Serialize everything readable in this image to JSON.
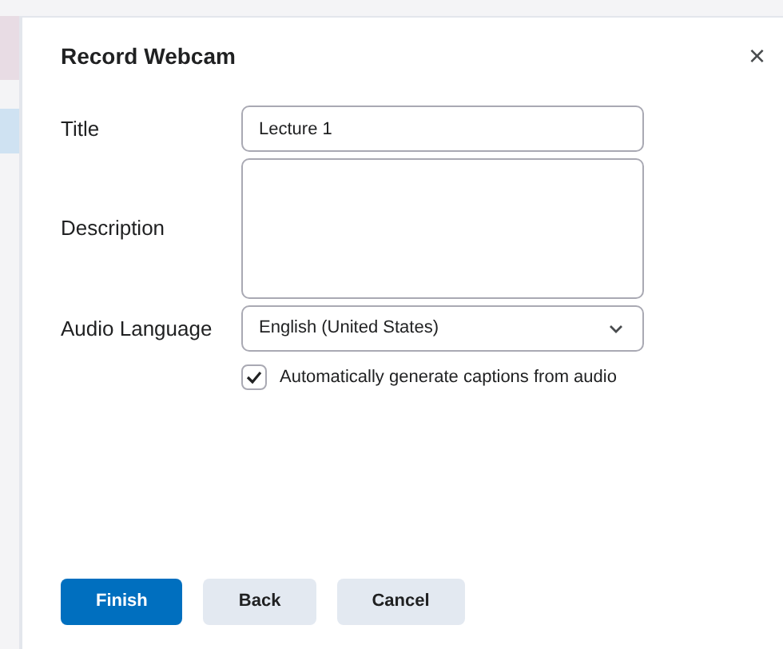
{
  "dialog": {
    "title": "Record Webcam",
    "close": "×"
  },
  "fields": [
    {
      "kind": "text",
      "label": "Title",
      "value": "Lecture 1"
    },
    {
      "kind": "textarea",
      "label": "Description"
    },
    {
      "kind": "select",
      "label": "Audio Language",
      "value": "English (United States)"
    }
  ],
  "captions": {
    "label": "Automatically generate captions from audio",
    "checked": true
  },
  "buttons": [
    {
      "label": "Finish",
      "primary": true
    },
    {
      "label": "Back",
      "primary": false
    },
    {
      "label": "Cancel",
      "primary": false
    }
  ]
}
